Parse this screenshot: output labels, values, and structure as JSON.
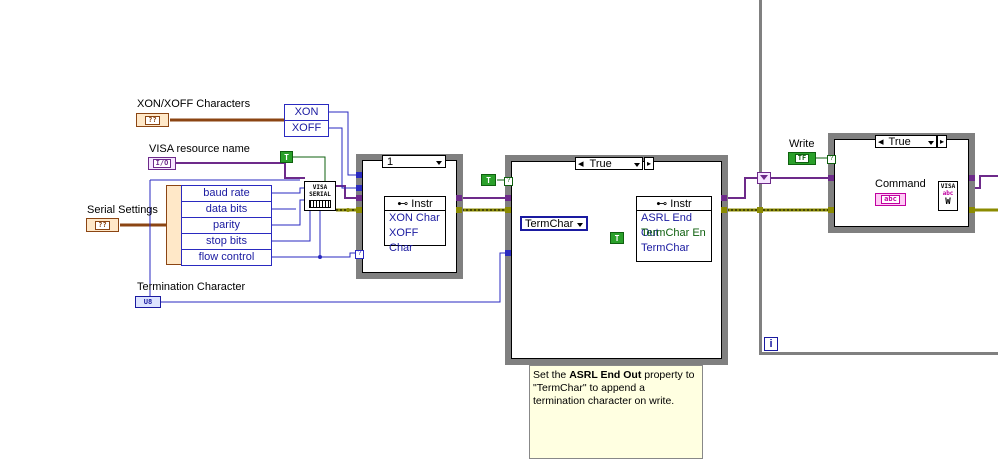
{
  "controls": {
    "xon_xoff": {
      "label": "XON/XOFF Characters",
      "glyph": "??"
    },
    "visa_resource": {
      "label": "VISA resource name",
      "glyph": "I/O"
    },
    "serial_settings": {
      "label": "Serial Settings",
      "glyph": "??"
    },
    "termination_char": {
      "label": "Termination Character",
      "glyph": "U8"
    },
    "write": {
      "label": "Write",
      "glyph": "TF"
    },
    "command": {
      "label": "Command",
      "glyph": "abc"
    }
  },
  "bundle_xon": {
    "rows": [
      "XON",
      "XOFF"
    ]
  },
  "bundle_serial": {
    "rows": [
      "baud rate",
      "data bits",
      "parity",
      "stop bits",
      "flow control"
    ]
  },
  "constants": {
    "true_glyph": "T"
  },
  "case_1": {
    "selector": "1"
  },
  "case_2": {
    "selector": "True"
  },
  "case_3": {
    "selector": "True"
  },
  "prop_node_1": {
    "header": "Instr",
    "rows": [
      "XON Char",
      "XOFF Char"
    ]
  },
  "prop_node_2": {
    "header": "Instr",
    "rows": [
      "ASRL End Out",
      "TermChar En",
      "TermChar"
    ]
  },
  "termchar_enum": {
    "value": "TermChar"
  },
  "visa_serial": {
    "line1": "VISA",
    "line2": "SERIAL"
  },
  "visa_write": {
    "line1": "VISA",
    "line2": "abc",
    "line3": "W"
  },
  "comment": {
    "pre": "Set the ",
    "bold": "ASRL End Out",
    "post": " property to \"TermChar\" to append a termination character on write."
  },
  "loop": {
    "iteration_glyph": "i"
  },
  "colors": {
    "refnum": "#6d2a8a",
    "error": "#8b8b00",
    "numeric": "#2a2ac0",
    "boolean": "#0f600f",
    "cluster": "#8b4513",
    "string": "#c000a0"
  }
}
